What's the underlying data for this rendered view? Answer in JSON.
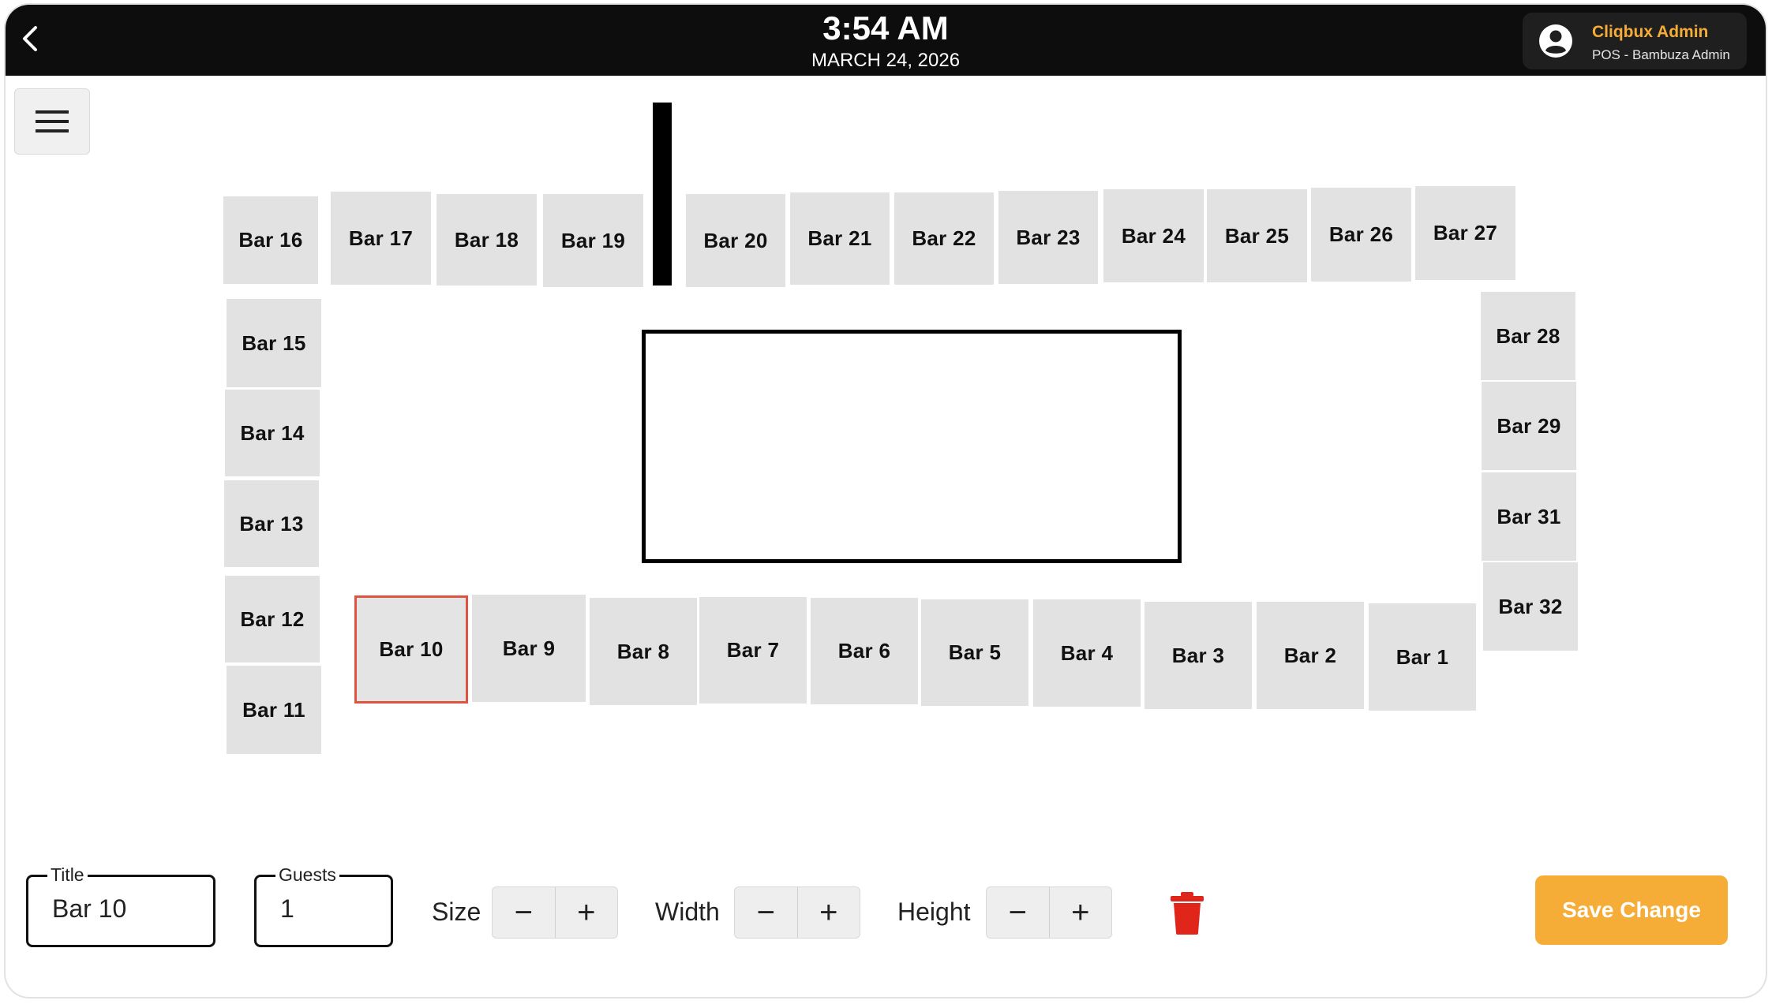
{
  "header": {
    "time": "3:54 AM",
    "date": "MARCH 24, 2026",
    "user_name": "Cliqbux Admin",
    "user_role": "POS - Bambuza Admin"
  },
  "tables": [
    {
      "label": "Bar 16"
    },
    {
      "label": "Bar 17"
    },
    {
      "label": "Bar 18"
    },
    {
      "label": "Bar 19"
    },
    {
      "label": "Bar 20"
    },
    {
      "label": "Bar 21"
    },
    {
      "label": "Bar 22"
    },
    {
      "label": "Bar 23"
    },
    {
      "label": "Bar 24"
    },
    {
      "label": "Bar 25"
    },
    {
      "label": "Bar 26"
    },
    {
      "label": "Bar 27"
    },
    {
      "label": "Bar 15"
    },
    {
      "label": "Bar 14"
    },
    {
      "label": "Bar 13"
    },
    {
      "label": "Bar 12"
    },
    {
      "label": "Bar 11"
    },
    {
      "label": "Bar 28"
    },
    {
      "label": "Bar 29"
    },
    {
      "label": "Bar 31"
    },
    {
      "label": "Bar 32"
    },
    {
      "label": "Bar 10"
    },
    {
      "label": "Bar 9"
    },
    {
      "label": "Bar 8"
    },
    {
      "label": "Bar 7"
    },
    {
      "label": "Bar 6"
    },
    {
      "label": "Bar 5"
    },
    {
      "label": "Bar 4"
    },
    {
      "label": "Bar 3"
    },
    {
      "label": "Bar 2"
    },
    {
      "label": "Bar 1"
    }
  ],
  "editor": {
    "title_label": "Title",
    "title_value": "Bar 10",
    "guests_label": "Guests",
    "guests_value": "1",
    "size_label": "Size",
    "width_label": "Width",
    "height_label": "Height",
    "minus": "−",
    "plus": "+",
    "save_label": "Save Change"
  },
  "colors": {
    "accent": "#f6ad37",
    "selected_border": "#e0533f",
    "delete": "#e0261b",
    "table_fill": "#e2e2e2"
  }
}
